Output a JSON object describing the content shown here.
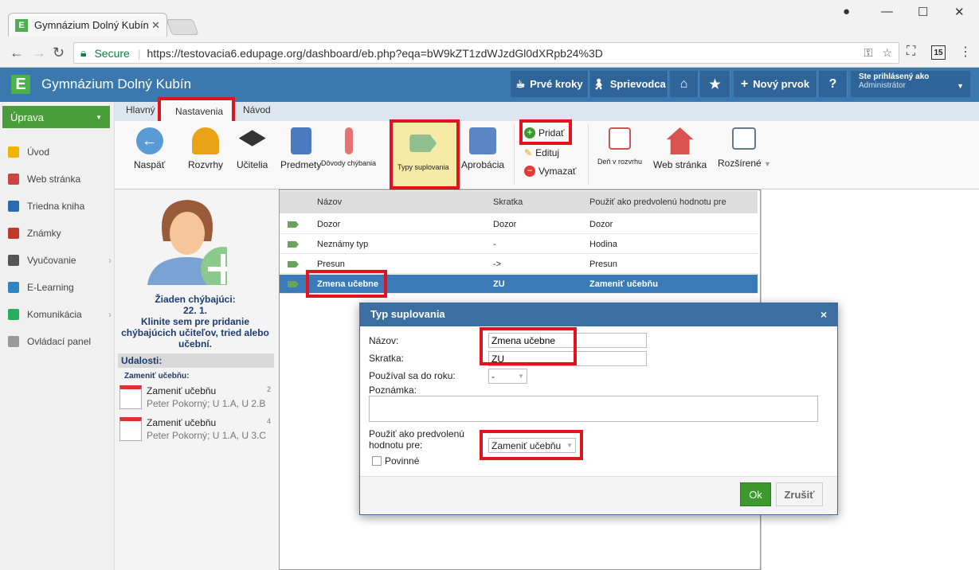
{
  "browser": {
    "tab_title": "Gymnázium Dolný Kubín",
    "secure_label": "Secure",
    "url_host": "https://testovacia6.edupage.org",
    "url_path": "/dashboard/eb.php?eqa=bW9kZT1zdWJzdGl0dXRpb24%3D",
    "ext_badge": "15"
  },
  "app": {
    "logo_letter": "E",
    "title": "Gymnázium Dolný Kubín",
    "toolbar": {
      "prve_kroky": "Prvé kroky",
      "sprievodca": "Sprievodca",
      "novy_prvok": "Nový prvok",
      "help": "?"
    },
    "logged": {
      "label": "Ste prihlásený ako",
      "user": "Administrátor"
    }
  },
  "sidebar": {
    "uprava": "Úprava",
    "items": [
      {
        "label": "Úvod",
        "color": "#f0b400"
      },
      {
        "label": "Web stránka",
        "color": "#c44"
      },
      {
        "label": "Triedna kniha",
        "color": "#2b6cb0"
      },
      {
        "label": "Známky",
        "color": "#c0392b"
      },
      {
        "label": "Vyučovanie",
        "color": "#555",
        "arrow": "›"
      },
      {
        "label": "E-Learning",
        "color": "#2e86c1"
      },
      {
        "label": "Komunikácia",
        "color": "#27ae60",
        "arrow": "›"
      },
      {
        "label": "Ovládací panel",
        "color": "#999"
      }
    ]
  },
  "ribbon_tabs": [
    "Hlavný",
    "Nastavenia",
    "Návod"
  ],
  "ribbon": {
    "naspat": "Naspäť",
    "rozvrhy": "Rozvrhy",
    "ucitelia": "Učitelia",
    "predmety": "Predmety",
    "dovody": "Dôvody chýbania",
    "typy": "Typy suplovania",
    "aprobacia": "Aprobácia",
    "pridat": "Pridať",
    "edituj": "Edituj",
    "vymazat": "Vymazať",
    "den": "Deň v rozvrhu",
    "web": "Web stránka",
    "rozsirene": "Rozšírené"
  },
  "left_panel": {
    "no_missing_line1": "Žiaden chýbajúci:",
    "no_missing_line2": "22. 1.",
    "no_missing_line3": "Klinite sem pre pridanie chýbajúcich učiteľov, tried alebo učební.",
    "events_header": "Udalosti:",
    "events_sub": "Zameniť učebňu:",
    "events": [
      {
        "title": "Zameniť učebňu",
        "sub": "Peter Pokorný; U 1.A, U 2.B",
        "num": "2"
      },
      {
        "title": "Zameniť učebňu",
        "sub": "Peter Pokorný; U 1.A, U 3.C",
        "num": "4"
      }
    ]
  },
  "grid": {
    "headers": [
      "Názov",
      "Skratka",
      "Použiť ako predvolenú hodnotu pre"
    ],
    "rows": [
      [
        "Dozor",
        "Dozor",
        "Dozor"
      ],
      [
        "Neznámy typ",
        "-",
        "Hodina"
      ],
      [
        "Presun",
        "->",
        "Presun"
      ],
      [
        "Zmena učebne",
        "ZU",
        "Zameniť učebňu"
      ]
    ]
  },
  "dialog": {
    "title": "Typ suplovania",
    "close": "×",
    "nazov_label": "Názov:",
    "nazov_value": "Zmena učebne",
    "skratka_label": "Skratka:",
    "skratka_value": "ZU",
    "rok_label": "Používal sa do roku:",
    "rok_value": "-",
    "poznamka_label": "Poznámka:",
    "default_label": "Použiť ako predvolenú hodnotu pre:",
    "default_value": "Zameniť učebňu",
    "povinne": "Povinné",
    "ok": "Ok",
    "cancel": "Zrušiť"
  },
  "colors": {
    "accent": "#3b78ad",
    "highlight": "#e0141e",
    "green": "#4a9e3a"
  }
}
